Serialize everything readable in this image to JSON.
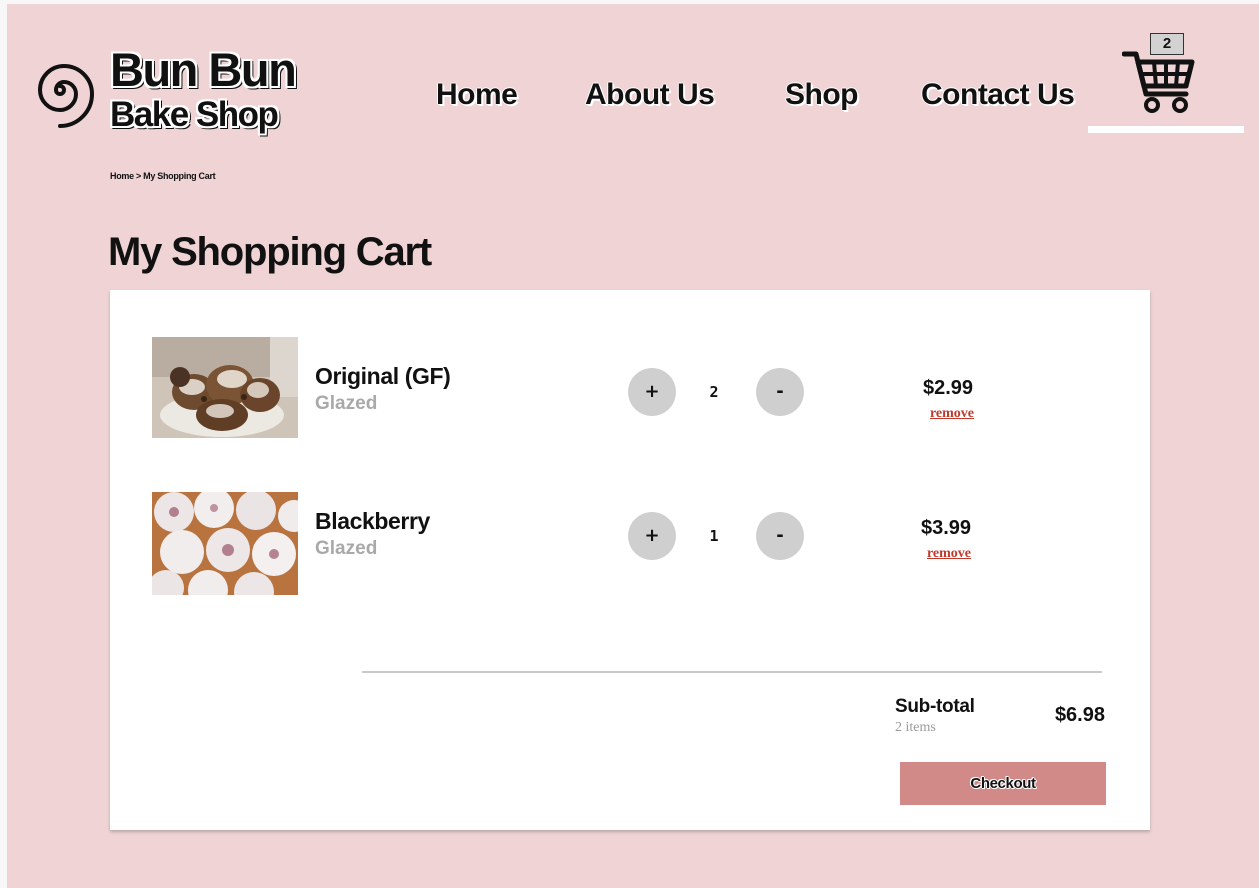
{
  "brand": {
    "line1": "Bun Bun",
    "line2": "Bake Shop"
  },
  "nav": {
    "home": "Home",
    "about": "About Us",
    "shop": "Shop",
    "contact": "Contact Us"
  },
  "cart": {
    "count": "2"
  },
  "breadcrumb": "Home > My Shopping Cart",
  "page_title": "My Shopping Cart",
  "items": [
    {
      "name": "Original (GF)",
      "subtitle": "Glazed",
      "plus": "+",
      "quantity": "2",
      "minus": "-",
      "price": "$2.99",
      "remove": "remove"
    },
    {
      "name": "Blackberry",
      "subtitle": "Glazed",
      "plus": "+",
      "quantity": "1",
      "minus": "-",
      "price": "$3.99",
      "remove": "remove"
    }
  ],
  "summary": {
    "label": "Sub-total",
    "count": "2 items",
    "total": "$6.98"
  },
  "checkout": {
    "label": "Checkout"
  },
  "colors": {
    "background": "#efd3d5",
    "checkout": "#d28a89",
    "remove": "#c0392b",
    "qty_button": "#cfcfcf"
  }
}
